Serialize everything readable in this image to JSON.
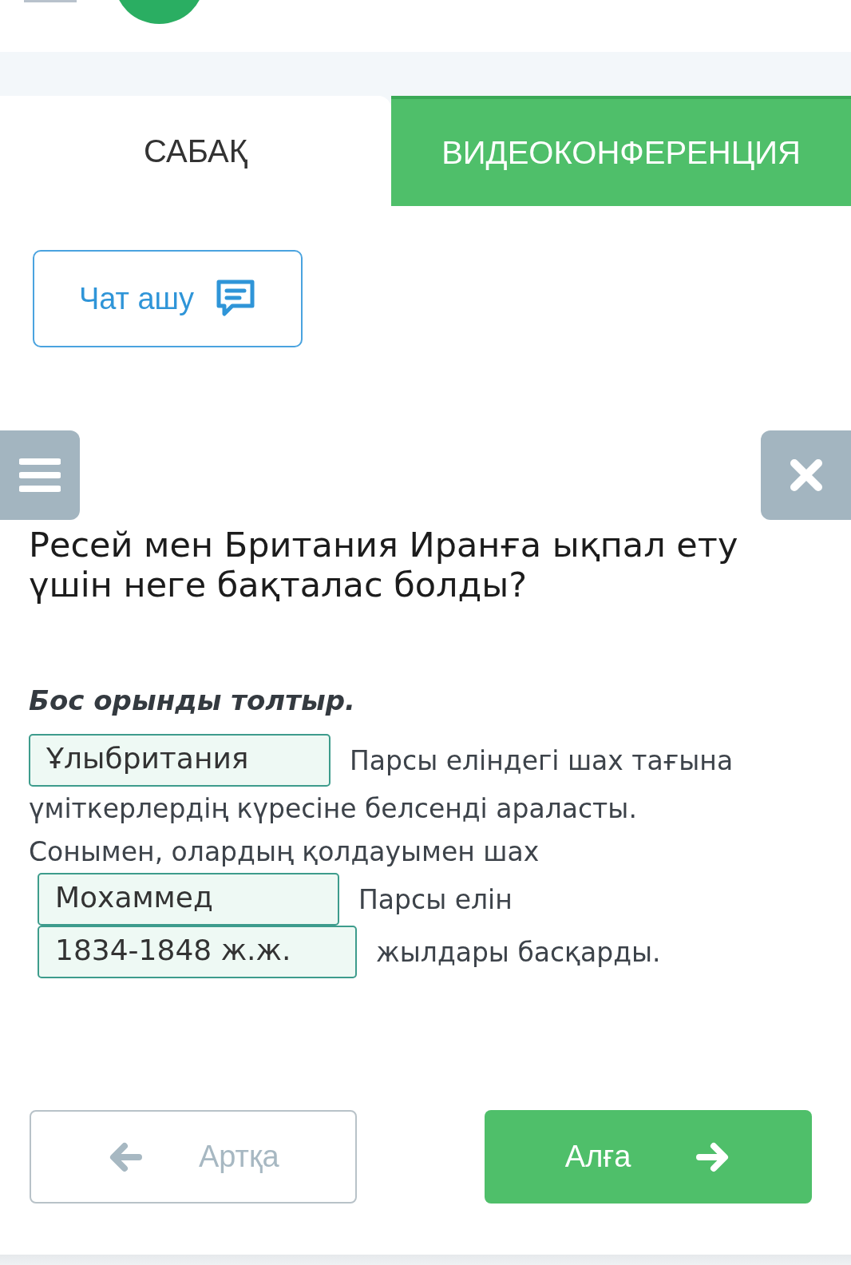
{
  "tabs": [
    {
      "label": "САБАҚ",
      "selected": true
    },
    {
      "label": "ВИДЕОКОНФЕРЕНЦИЯ",
      "selected": false
    }
  ],
  "chat_button": {
    "label": "Чат ашу"
  },
  "question": "Ресей мен Британия Иранға ықпал ету үшін неге бақталас болды?",
  "instruction": "Бос орынды толтыр.",
  "lines": [
    [
      {
        "kind": "blank",
        "value": "Ұлыбритания"
      },
      {
        "kind": "text",
        "text": "Парсы еліндегі шах тағына"
      }
    ],
    [
      {
        "kind": "text",
        "text": "үміткерлердің күресіне белсенді араласты."
      }
    ],
    [
      {
        "kind": "text",
        "text": "Сонымен, олардың қолдауымен шах"
      }
    ],
    [
      {
        "kind": "blank",
        "value": "Мохаммед"
      },
      {
        "kind": "text",
        "text": "Парсы елін"
      }
    ],
    [
      {
        "kind": "blank",
        "value": "1834-1848 ж.ж."
      },
      {
        "kind": "text",
        "text": "жылдары басқарды."
      }
    ]
  ],
  "nav": [
    {
      "kind": "back",
      "label": "Артқа",
      "disabled": true
    },
    {
      "kind": "next",
      "label": "Алға",
      "disabled": false
    }
  ]
}
